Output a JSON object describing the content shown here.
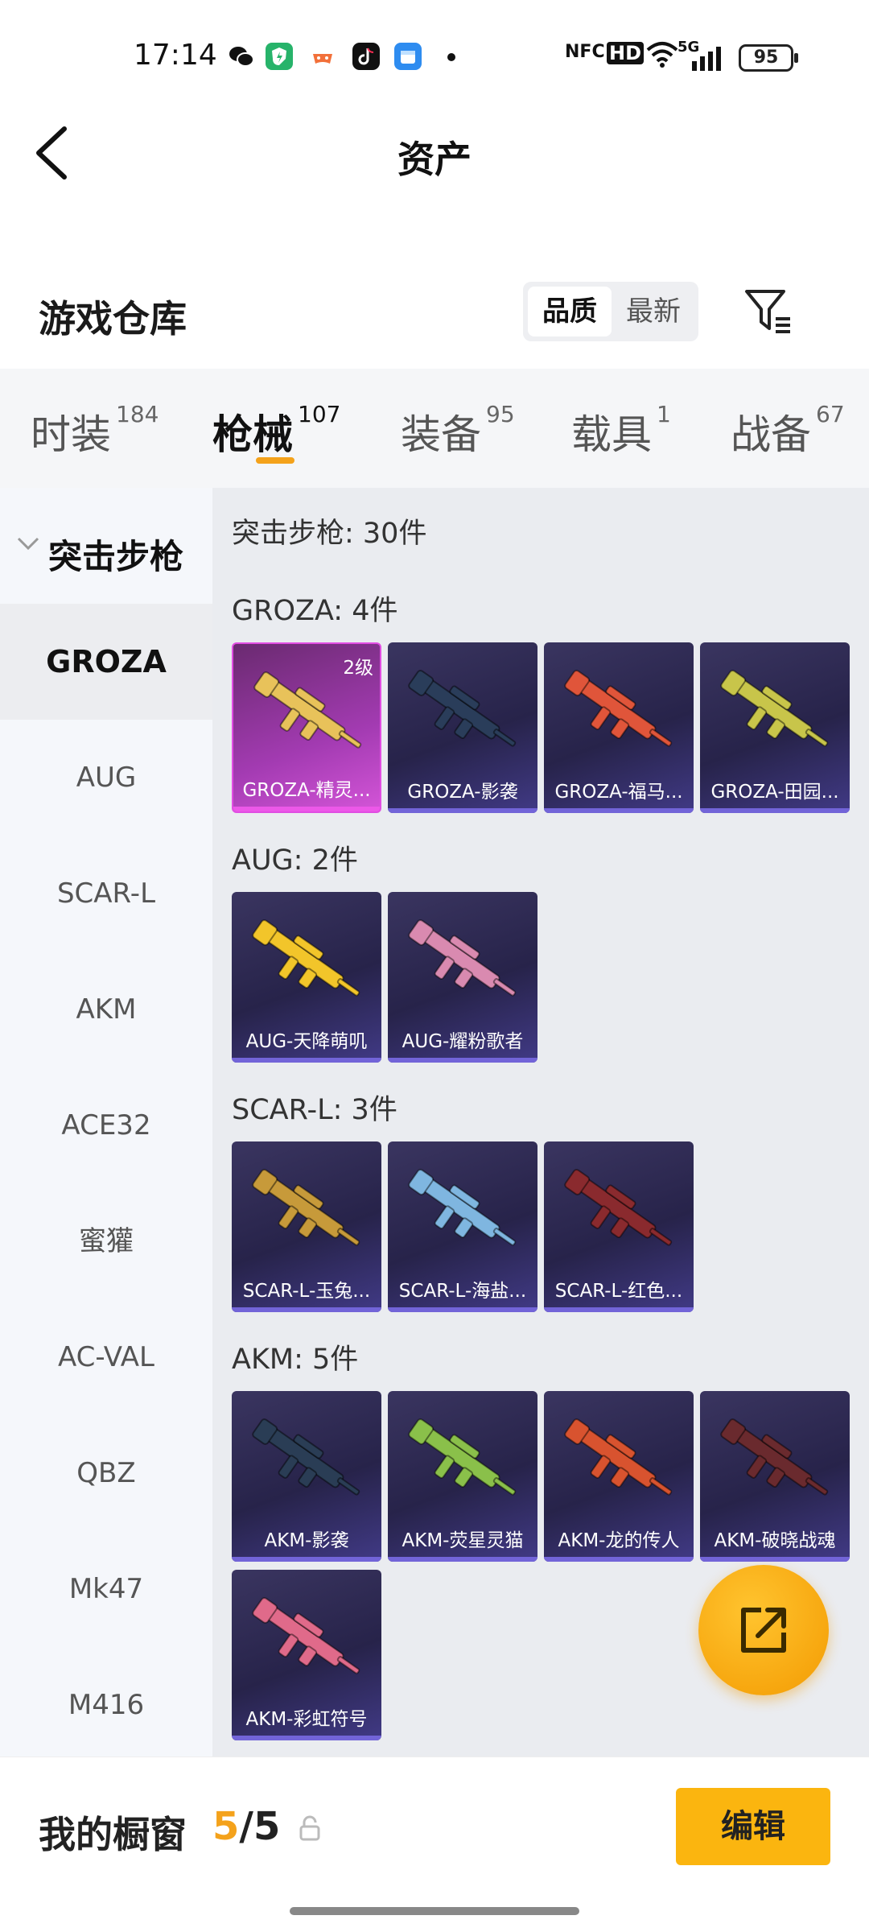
{
  "status": {
    "time": "17:14",
    "battery": "95",
    "indicators": [
      "NFC",
      "HD",
      "5G"
    ],
    "notification_icons": [
      "wechat-icon",
      "security-app-icon",
      "game-icon",
      "tiktok-icon",
      "calendar-app-icon"
    ]
  },
  "nav": {
    "title": "资产"
  },
  "header": {
    "heading": "游戏仓库",
    "sort_options": [
      "品质",
      "最新"
    ],
    "active_sort": "品质"
  },
  "tabs": [
    {
      "label": "时装",
      "count": "184"
    },
    {
      "label": "枪械",
      "count": "107"
    },
    {
      "label": "装备",
      "count": "95"
    },
    {
      "label": "载具",
      "count": "1"
    },
    {
      "label": "战备",
      "count": "67"
    }
  ],
  "sidebar": {
    "group": "突击步枪",
    "items": [
      "GROZA",
      "AUG",
      "SCAR-L",
      "AKM",
      "ACE32",
      "蜜獾",
      "AC-VAL",
      "QBZ",
      "Mk47",
      "M416"
    ]
  },
  "content": {
    "summary": "突击步枪: 30件",
    "sections": [
      {
        "title": "GROZA: 4件",
        "items": [
          {
            "name": "GROZA-精灵...",
            "level": "2级",
            "color": "#e8c25a"
          },
          {
            "name": "GROZA-影袭",
            "color": "#2a3d5a"
          },
          {
            "name": "GROZA-福马...",
            "color": "#e0553a"
          },
          {
            "name": "GROZA-田园...",
            "color": "#c8c54a"
          }
        ]
      },
      {
        "title": "AUG: 2件",
        "items": [
          {
            "name": "AUG-天降萌叽",
            "color": "#f2c52a"
          },
          {
            "name": "AUG-耀粉歌者",
            "color": "#d98ab0"
          }
        ]
      },
      {
        "title": "SCAR-L: 3件",
        "items": [
          {
            "name": "SCAR-L-玉兔...",
            "color": "#c79a3a"
          },
          {
            "name": "SCAR-L-海盐...",
            "color": "#7fb6e0"
          },
          {
            "name": "SCAR-L-红色...",
            "color": "#8a2a2e"
          }
        ]
      },
      {
        "title": "AKM: 5件",
        "items": [
          {
            "name": "AKM-影袭",
            "color": "#2a3d55"
          },
          {
            "name": "AKM-荧星灵猫",
            "color": "#8ac04a"
          },
          {
            "name": "AKM-龙的传人",
            "color": "#d8532f"
          },
          {
            "name": "AKM-破晓战魂",
            "color": "#6a2a2e"
          },
          {
            "name": "AKM-彩虹符号",
            "color": "#e06a8a"
          }
        ]
      }
    ]
  },
  "bottom": {
    "label": "我的橱窗",
    "current": "5",
    "separator": "/",
    "total": "5",
    "edit_label": "编辑"
  },
  "colors": {
    "accent": "#f4a21b",
    "button": "#fbb50f",
    "card_bg": "#2c284f"
  }
}
